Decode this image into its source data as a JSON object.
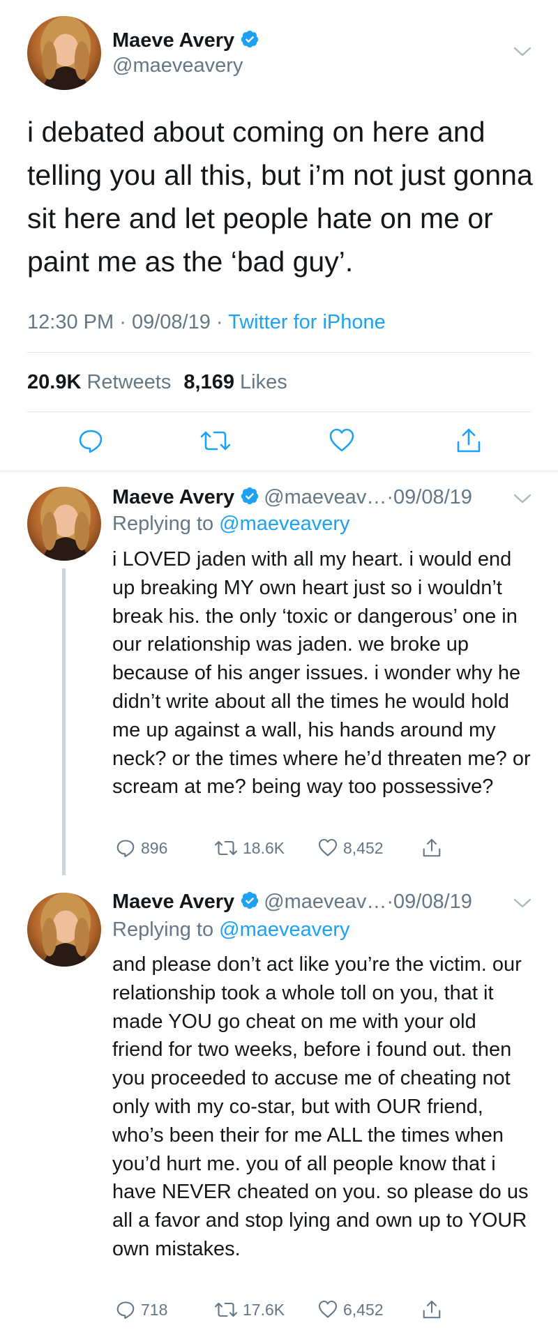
{
  "colors": {
    "accent": "#1da1f2",
    "text": "#14171a",
    "muted": "#657786",
    "border": "#e1e8ed",
    "thread_line": "#ccd6dd"
  },
  "main_tweet": {
    "user": {
      "name": "Maeve Avery",
      "handle": "@maeveavery",
      "verified": true
    },
    "text": "i debated about coming on here and telling you all this, but i’m not just gonna sit here and let people hate on me or paint me as the ‘bad guy’.",
    "meta": {
      "time": "12:30 PM",
      "date": "09/08/19",
      "separator": "·",
      "source": "Twitter for iPhone"
    },
    "stats": {
      "retweets_count": "20.9K",
      "retweets_label": "Retweets",
      "likes_count": "8,169",
      "likes_label": "Likes"
    },
    "actions": [
      "reply-icon",
      "retweet-icon",
      "like-icon",
      "share-icon"
    ]
  },
  "replies": [
    {
      "name": "Maeve Avery",
      "handle": "@maeveav…",
      "separator": " · ",
      "date": "09/08/19",
      "replying_label": "Replying to ",
      "replying_to": "@maeveavery",
      "text": "i LOVED jaden with all my heart. i would end up breaking MY own heart just so i wouldn’t break his. the only ‘toxic or dangerous’ one in our relationship was jaden. we broke up because of his anger issues. i wonder why he didn’t write about all the times he would hold me up against a wall, his hands around my neck? or the times where he’d threaten me? or scream at me? being way too possessive?",
      "reply_count": "896",
      "retweet_count": "18.6K",
      "like_count": "8,452"
    },
    {
      "name": "Maeve Avery",
      "handle": "@maeveav…",
      "separator": " · ",
      "date": "09/08/19",
      "replying_label": "Replying to ",
      "replying_to": "@maeveavery",
      "text": "and please don’t act like you’re the victim. our relationship took a whole toll on you, that it made YOU go cheat on me with your old friend for two weeks, before i found out. then you proceeded to accuse me of cheating not only with my co-star, but with OUR friend, who’s been their for me ALL the times when you’d hurt me. you of all people know that i have NEVER cheated on you. so please do us all a favor and stop lying and own up to YOUR own mistakes.",
      "reply_count": "718",
      "retweet_count": "17.6K",
      "like_count": "6,452"
    }
  ]
}
